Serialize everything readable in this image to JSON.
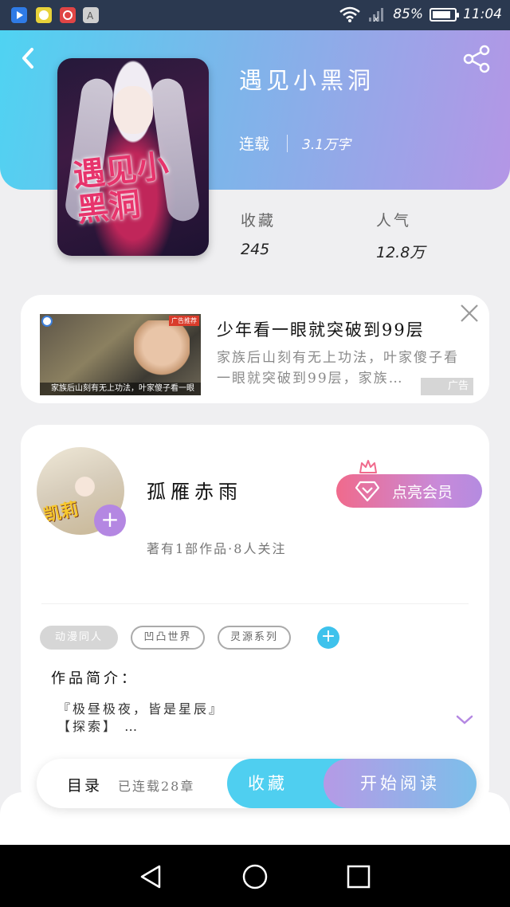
{
  "status_bar": {
    "battery": "85%",
    "battery_level": 0.85,
    "time": "11:04",
    "apps": [
      {
        "name": "video-app-icon",
        "color": "#2f7be6"
      },
      {
        "name": "chat-app-icon",
        "color": "#e8d23a"
      },
      {
        "name": "huawei-app-icon",
        "color": "#e04545"
      },
      {
        "name": "store-app-icon",
        "color": "#cfcfcf"
      }
    ]
  },
  "book": {
    "title": "遇见小黑洞",
    "status": "连载",
    "word_count": "3.1万字",
    "cover_art_text": "遇见小黑洞"
  },
  "stats": {
    "favorites_label": "收藏",
    "favorites_value": "245",
    "popularity_label": "人气",
    "popularity_value": "12.8万"
  },
  "ad": {
    "title": "少年看一眼就突破到99层",
    "description": "家族后山刻有无上功法，叶家傻子看一眼就突破到99层，家族…",
    "image_caption": "家族后山刻有无上功法，叶家傻子看一眼",
    "tag": "广告"
  },
  "author": {
    "name": "孤雁赤雨",
    "meta": "著有1部作品·8人关注",
    "vip_button": "点亮会员",
    "tags": [
      "动漫同人",
      "凹凸世界",
      "灵源系列"
    ],
    "intro_label": "作品简介：",
    "intro_text": "『极昼极夜，皆是星辰』\n【探索】 …"
  },
  "action_bar": {
    "toc_label": "目录",
    "toc_count": "已连载28章",
    "favorite_button": "收藏",
    "read_button": "开始阅读"
  },
  "colors": {
    "header_gradient_start": "#4fd3f2",
    "header_gradient_end": "#b496e6",
    "favorite_button": "#4fcff0",
    "vip_gradient_start": "#f06a8c",
    "vip_gradient_end": "#b48be0",
    "tag_add": "#3ec2ec"
  }
}
